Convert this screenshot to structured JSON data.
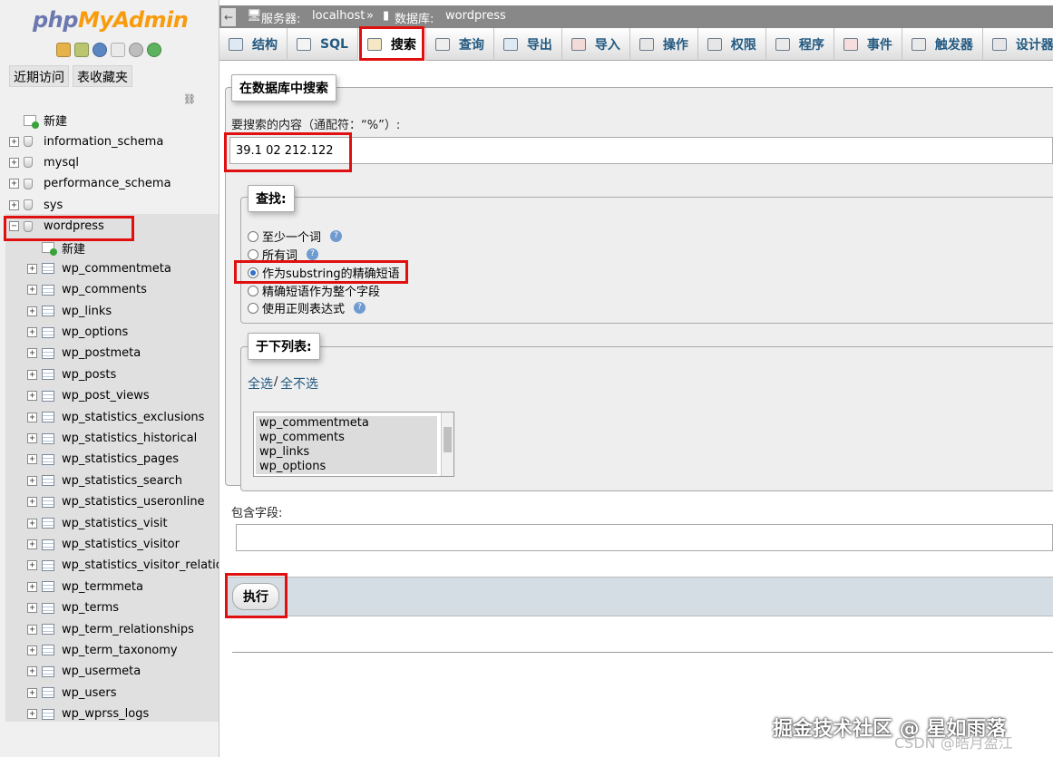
{
  "logo": {
    "php": "php",
    "admin": "MyAdmin"
  },
  "nav": {
    "tabs": [
      "近期访问",
      "表收藏夹"
    ],
    "tree": {
      "new_root": "新建",
      "databases": [
        "information_schema",
        "mysql",
        "performance_schema",
        "sys",
        "wordpress"
      ],
      "wordpress_children": {
        "new_label": "新建",
        "tables": [
          "wp_commentmeta",
          "wp_comments",
          "wp_links",
          "wp_options",
          "wp_postmeta",
          "wp_posts",
          "wp_post_views",
          "wp_statistics_exclusions",
          "wp_statistics_historical",
          "wp_statistics_pages",
          "wp_statistics_search",
          "wp_statistics_useronline",
          "wp_statistics_visit",
          "wp_statistics_visitor",
          "wp_statistics_visitor_relations",
          "wp_termmeta",
          "wp_terms",
          "wp_term_relationships",
          "wp_term_taxonomy",
          "wp_usermeta",
          "wp_users",
          "wp_wprss_logs"
        ]
      }
    }
  },
  "breadcrumb": {
    "server_label": "服务器:",
    "server_value": "localhost",
    "sep": "»",
    "db_label": "数据库:",
    "db_value": "wordpress"
  },
  "menu": [
    "结构",
    "SQL",
    "搜索",
    "查询",
    "导出",
    "导入",
    "操作",
    "权限",
    "程序",
    "事件",
    "触发器",
    "设计器"
  ],
  "menu_active": "搜索",
  "search": {
    "legend": "在数据库中搜索",
    "label": "要搜索的内容（通配符：“%”）:",
    "value": "39.1 02 212.122",
    "find_legend": "查找:",
    "options": [
      "至少一个词",
      "所有词",
      "作为substring的精确短语",
      "精确短语作为整个字段",
      "使用正则表达式"
    ],
    "selected_option": "作为substring的精确短语",
    "tables_legend": "于下列表:",
    "select_all": "全选",
    "slash": "/",
    "select_none": "全不选",
    "list_items": [
      "wp_commentmeta",
      "wp_comments",
      "wp_links",
      "wp_options"
    ],
    "field_label": "包含字段:",
    "field_value": "",
    "exec": "执行"
  },
  "watermark": {
    "line1": "掘金技术社区 @ 星如雨落",
    "line2": "CSDN @皓月盈江"
  },
  "colors": {
    "highlight": "#e01010",
    "link": "#235a81",
    "logo_php": "#6c78af",
    "logo_admin": "#f89c0e"
  }
}
